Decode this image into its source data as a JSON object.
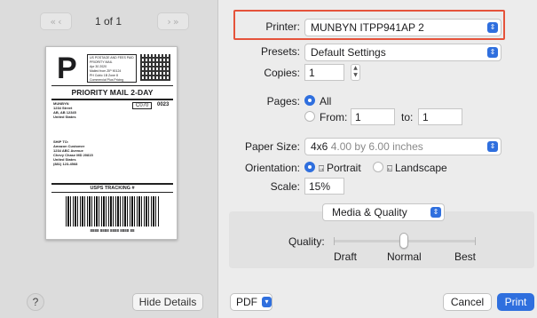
{
  "preview": {
    "page_indicator": "1 of 1",
    "nav_first": "«",
    "nav_prev": "‹",
    "nav_next": "›",
    "nav_last": "»",
    "label": {
      "big_letter": "P",
      "postage_lines": [
        "US POSTAGE AND FEES PAID",
        "PRIORITY MAIL",
        "Apr 30 2020",
        "Mailed from ZIP 90124",
        "PH Cubic 1B Zone 8",
        "Commercial Plus Pricing"
      ],
      "service": "PRIORITY MAIL 2-DAY",
      "from_lines": [
        "MUNBYN",
        "1234 Street",
        "AB, AB 12345",
        "United States"
      ],
      "code": "C070",
      "code_num": "0023",
      "to_lines": [
        "SHIP TO:",
        "Amazon Customer",
        "1234 ABC Avenue",
        "Chevy Chase MD 20815",
        "United States",
        "(881) 123-4568"
      ],
      "tracking_title": "USPS TRACKING #",
      "tracking_number": "8888 8888 8888 8888 88"
    },
    "help_label": "?",
    "hide_details_label": "Hide Details"
  },
  "settings": {
    "printer_label": "Printer:",
    "printer_value": "MUNBYN ITPP941AP 2",
    "presets_label": "Presets:",
    "presets_value": "Default Settings",
    "copies_label": "Copies:",
    "copies_value": "1",
    "pages_label": "Pages:",
    "pages_all": "All",
    "pages_from": "From:",
    "pages_from_value": "1",
    "pages_to": "to:",
    "pages_to_value": "1",
    "paper_size_label": "Paper Size:",
    "paper_size_name": "4x6",
    "paper_size_dims": "4.00 by 6.00 inches",
    "orientation_label": "Orientation:",
    "portrait": "Portrait",
    "landscape": "Landscape",
    "scale_label": "Scale:",
    "scale_value": "15%",
    "section_value": "Media & Quality",
    "quality_label": "Quality:",
    "quality_draft": "Draft",
    "quality_normal": "Normal",
    "quality_best": "Best",
    "quality_level": "Normal"
  },
  "footer": {
    "pdf_label": "PDF",
    "cancel_label": "Cancel",
    "print_label": "Print"
  },
  "colors": {
    "accent": "#2f6fde",
    "highlight": "#e5533b"
  }
}
